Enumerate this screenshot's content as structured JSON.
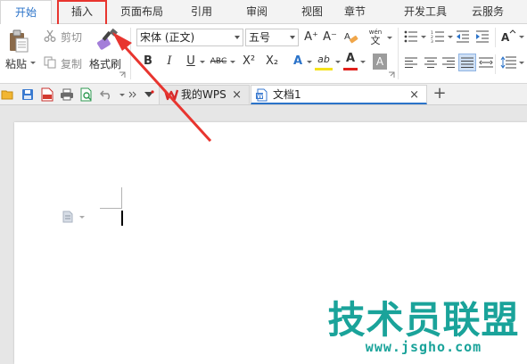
{
  "menu": {
    "tabs": [
      {
        "label": "开始",
        "active": true
      },
      {
        "label": "插入",
        "active": false,
        "highlighted": true
      },
      {
        "label": "页面布局",
        "active": false
      },
      {
        "label": "引用",
        "active": false
      },
      {
        "label": "审阅",
        "active": false
      },
      {
        "label": "视图",
        "active": false
      },
      {
        "label": "章节",
        "active": false
      },
      {
        "label": "开发工具",
        "active": false
      },
      {
        "label": "云服务",
        "active": false
      }
    ]
  },
  "ribbon": {
    "clipboard": {
      "paste_label": "粘贴",
      "cut_label": "剪切",
      "copy_label": "复制",
      "format_painter_label": "格式刷"
    },
    "font": {
      "font_name": "宋体 (正文)",
      "font_size": "五号",
      "bold": "B",
      "italic": "I",
      "underline": "U",
      "strikethrough": "ABC",
      "superscript": "X²",
      "subscript": "X₂",
      "text_effect": "A",
      "highlight": "ab",
      "font_color": "A",
      "char_shading": "A",
      "grow_font": "A⁺",
      "shrink_font": "A⁻",
      "phonetic_top": "wén",
      "phonetic_bottom": "文"
    },
    "colors": {
      "accent": "#2b73c9",
      "highlight_yellow": "#f5e21b",
      "font_color_red": "#e0201c"
    }
  },
  "doc_tabs": [
    {
      "label": "我的WPS",
      "active": false,
      "close": "×"
    },
    {
      "label": "文档1",
      "active": true,
      "close": "×"
    }
  ],
  "new_tab": "+",
  "watermark": {
    "title": "技术员联盟",
    "url": "www.jsgho.com"
  },
  "annotation": {
    "color": "#e8352f"
  }
}
